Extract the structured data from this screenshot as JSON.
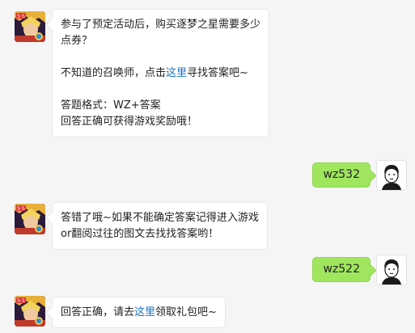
{
  "messages": [
    {
      "sender": "bot",
      "line1": "参与了预定活动后，购买逐梦之星需要多少",
      "line2": "点券？",
      "line3_pre": "不知道的召唤师，点击",
      "line3_link": "这里",
      "line3_post": "寻找答案吧~",
      "line4": "答题格式：WZ+答案",
      "line5": "回答正确可获得游戏奖励哦！"
    },
    {
      "sender": "user",
      "text": "wz532"
    },
    {
      "sender": "bot",
      "line1": "答错了哦~如果不能确定答案记得进入游戏",
      "line2": "or翻阅过往的图文去找找答案哟！"
    },
    {
      "sender": "user",
      "text": "wz522"
    },
    {
      "sender": "bot",
      "pre": "回答正确，请去",
      "link": "这里",
      "post": "领取礼包吧~"
    }
  ],
  "colors": {
    "background": "#f5f5f5",
    "user_bubble": "#9fe65e",
    "link": "#1a73c8"
  },
  "icons": {
    "bot_avatar": "game-hero-avatar",
    "user_avatar": "cartoon-man-avatar"
  }
}
